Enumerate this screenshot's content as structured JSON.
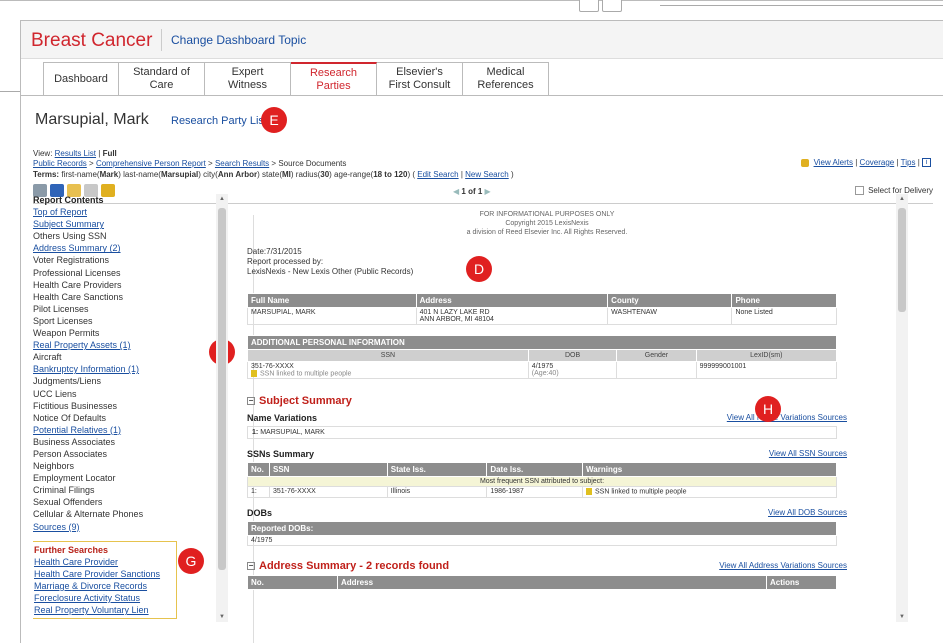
{
  "header": {
    "brand": "Breast Cancer",
    "change_topic": "Change Dashboard Topic"
  },
  "tabs": [
    {
      "label": "Dashboard"
    },
    {
      "label": "Standard of\nCare"
    },
    {
      "label": "Expert\nWitness"
    },
    {
      "label": "Research\nParties"
    },
    {
      "label": "Elsevier's\nFirst Consult"
    },
    {
      "label": "Medical\nReferences"
    }
  ],
  "person": {
    "name": "Marsupial, Mark",
    "research_party_list": "Research Party List"
  },
  "badges": {
    "e": "E",
    "d": "D",
    "f": "F",
    "g": "G",
    "h": "H"
  },
  "view": {
    "label": "View:",
    "results_list": "Results List",
    "sep": "|",
    "full": "Full"
  },
  "breadcrumbs": {
    "public_records": "Public Records",
    "comprehensive": "Comprehensive Person Report",
    "search_results": "Search Results",
    "current": "Source Documents",
    "gt": ">"
  },
  "terms": {
    "label": "Terms:",
    "text1": "first-name(",
    "first": "Mark",
    "text2": ") last-name(",
    "last": "Marsupial",
    "text3": ") city(",
    "city": "Ann Arbor",
    "text4": ") state(",
    "state": "MI",
    "text5": ") radius(",
    "radius": "30",
    "text6": ") age-range(",
    "age": "18 to 120",
    "text7": ") (",
    "edit": "Edit Search",
    "pipe": "|",
    "new": "New Search",
    "text8": ")"
  },
  "right_links": {
    "alerts": "View Alerts",
    "coverage": "Coverage",
    "tips": "Tips",
    "pipe": "|",
    "info": "i"
  },
  "pager": {
    "text": "1 of 1",
    "prev": "◀",
    "next": "▶"
  },
  "select_delivery": "Select for Delivery",
  "left_nav": {
    "title": "Report Contents",
    "items": [
      {
        "label": "Top of Report",
        "link": true
      },
      {
        "label": "Subject Summary",
        "link": true
      },
      {
        "label": "Others Using SSN",
        "link": false
      },
      {
        "label": "Address Summary (2)",
        "link": true
      },
      {
        "label": "Voter Registrations",
        "link": false
      },
      {
        "label": "Professional Licenses",
        "link": false
      },
      {
        "label": "Health Care Providers",
        "link": false
      },
      {
        "label": "Health Care Sanctions",
        "link": false
      },
      {
        "label": "Pilot Licenses",
        "link": false
      },
      {
        "label": "Sport Licenses",
        "link": false
      },
      {
        "label": "Weapon Permits",
        "link": false
      },
      {
        "label": "Real Property Assets (1)",
        "link": true
      },
      {
        "label": "Aircraft",
        "link": false
      },
      {
        "label": "Bankruptcy Information (1)",
        "link": true
      },
      {
        "label": "Judgments/Liens",
        "link": false
      },
      {
        "label": "UCC Liens",
        "link": false
      },
      {
        "label": "Fictitious Businesses",
        "link": false
      },
      {
        "label": "Notice Of Defaults",
        "link": false
      },
      {
        "label": "Potential Relatives (1)",
        "link": true
      },
      {
        "label": "Business Associates",
        "link": false
      },
      {
        "label": "Person Associates",
        "link": false
      },
      {
        "label": "Neighbors",
        "link": false
      },
      {
        "label": "Employment Locator",
        "link": false
      },
      {
        "label": "Criminal Filings",
        "link": false
      },
      {
        "label": "Sexual Offenders",
        "link": false
      },
      {
        "label": "Cellular & Alternate Phones",
        "link": false
      },
      {
        "label": "Sources (9)",
        "link": true
      }
    ],
    "further_title": "Further Searches",
    "further": [
      "Health Care Provider",
      "Health Care Provider Sanctions",
      "Marriage & Divorce Records",
      "Foreclosure Activity Status",
      "Real Property Voluntary Lien"
    ]
  },
  "main": {
    "disclaimer1": "FOR INFORMATIONAL PURPOSES ONLY",
    "disclaimer2": "Copyright 2015 LexisNexis",
    "disclaimer3": "a division of Reed Elsevier Inc. All Rights Reserved.",
    "date": "Date:7/31/2015",
    "processed": "Report processed by:",
    "processor": "LexisNexis - New Lexis Other (Public Records)",
    "person_table": {
      "headers": [
        "Full Name",
        "Address",
        "County",
        "Phone"
      ],
      "row": {
        "name": "MARSUPIAL, MARK",
        "address1": "401 N LAZY LAKE RD",
        "address2": "ANN ARBOR, MI 48104",
        "county": "WASHTENAW",
        "phone": "None Listed"
      }
    },
    "additional": {
      "title": "ADDITIONAL PERSONAL INFORMATION",
      "headers": [
        "SSN",
        "DOB",
        "Gender",
        "LexID(sm)"
      ],
      "ssn": "351-76-XXXX",
      "ssn_note": "SSN linked to multiple people",
      "dob": "4/1975",
      "age": "(Age:40)",
      "gender": "",
      "lexid": "999999001001"
    },
    "subject_summary": "Subject Summary",
    "name_variations": "Name Variations",
    "view_all_names": "View All Name Variations Sources",
    "name_var_row": {
      "num": "1:",
      "value": "MARSUPIAL, MARK"
    },
    "ssns_summary": "SSNs Summary",
    "view_all_ssn": "View All SSN Sources",
    "ssn_table": {
      "headers": [
        "No.",
        "SSN",
        "State Iss.",
        "Date Iss.",
        "Warnings"
      ],
      "freq": "Most frequent SSN attributed to subject:",
      "row": {
        "num": "1:",
        "ssn": "351-76-XXXX",
        "state": "Illinois",
        "date": "1986-1987",
        "warning": "SSN linked to multiple people"
      }
    },
    "dobs": "DOBs",
    "view_all_dob": "View All DOB Sources",
    "reported_dobs": "Reported DOBs:",
    "dob_value": "4/1975",
    "address_summary": "Address Summary - 2 records found",
    "view_all_address": "View All Address Variations Sources",
    "address_headers": [
      "No.",
      "Address",
      "Actions"
    ]
  }
}
